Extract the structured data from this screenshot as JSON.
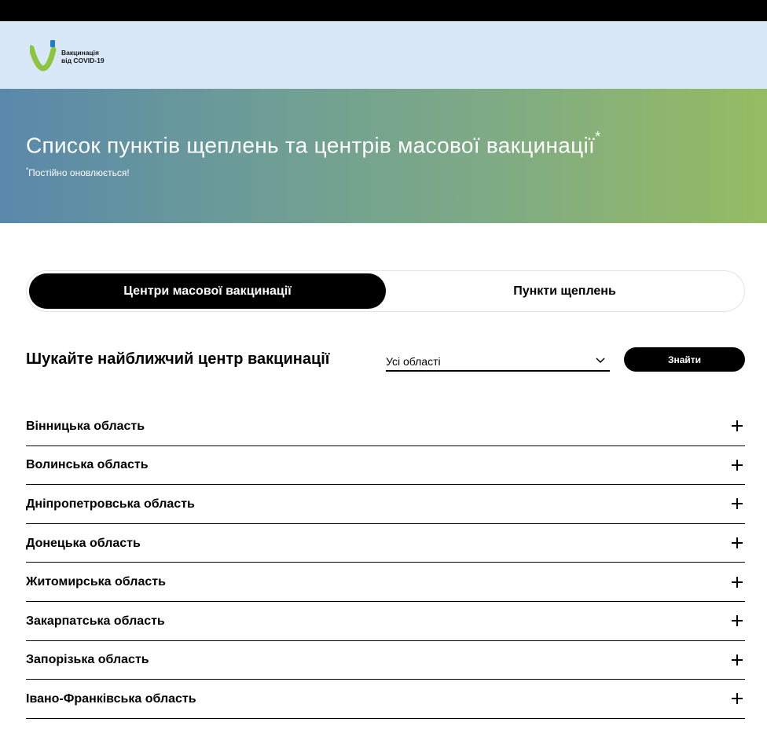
{
  "logo": {
    "line1": "Вакцинація",
    "line2": "від COVID-19"
  },
  "hero": {
    "title": "Список пунктів щеплень та центрів масової вакцинації",
    "title_mark": "*",
    "note_mark": "*",
    "note": "Постійно оновлюється!"
  },
  "tabs": [
    {
      "label": "Центри масової вакцинації",
      "active": true
    },
    {
      "label": "Пункти щеплень",
      "active": false
    }
  ],
  "search": {
    "title": "Шукайте найближчий центр вакцинації",
    "select_value": "Усі області",
    "button_label": "Знайти"
  },
  "regions": [
    {
      "label": "Вінницька область"
    },
    {
      "label": "Волинська область"
    },
    {
      "label": "Дніпропетровська область"
    },
    {
      "label": "Донецька область"
    },
    {
      "label": "Житомирська область"
    },
    {
      "label": "Закарпатська область"
    },
    {
      "label": "Запорізька область"
    },
    {
      "label": "Івано-Франківська область"
    }
  ],
  "colors": {
    "header_bg": "#d9e8f8",
    "gradient_start": "#5a88ab",
    "gradient_end": "#96bc62",
    "logo_green": "#8cc63f",
    "logo_blue": "#1f7fc4",
    "accent": "#000000"
  },
  "icons": {
    "select": "chevron-down-icon",
    "region": "plus-icon"
  }
}
